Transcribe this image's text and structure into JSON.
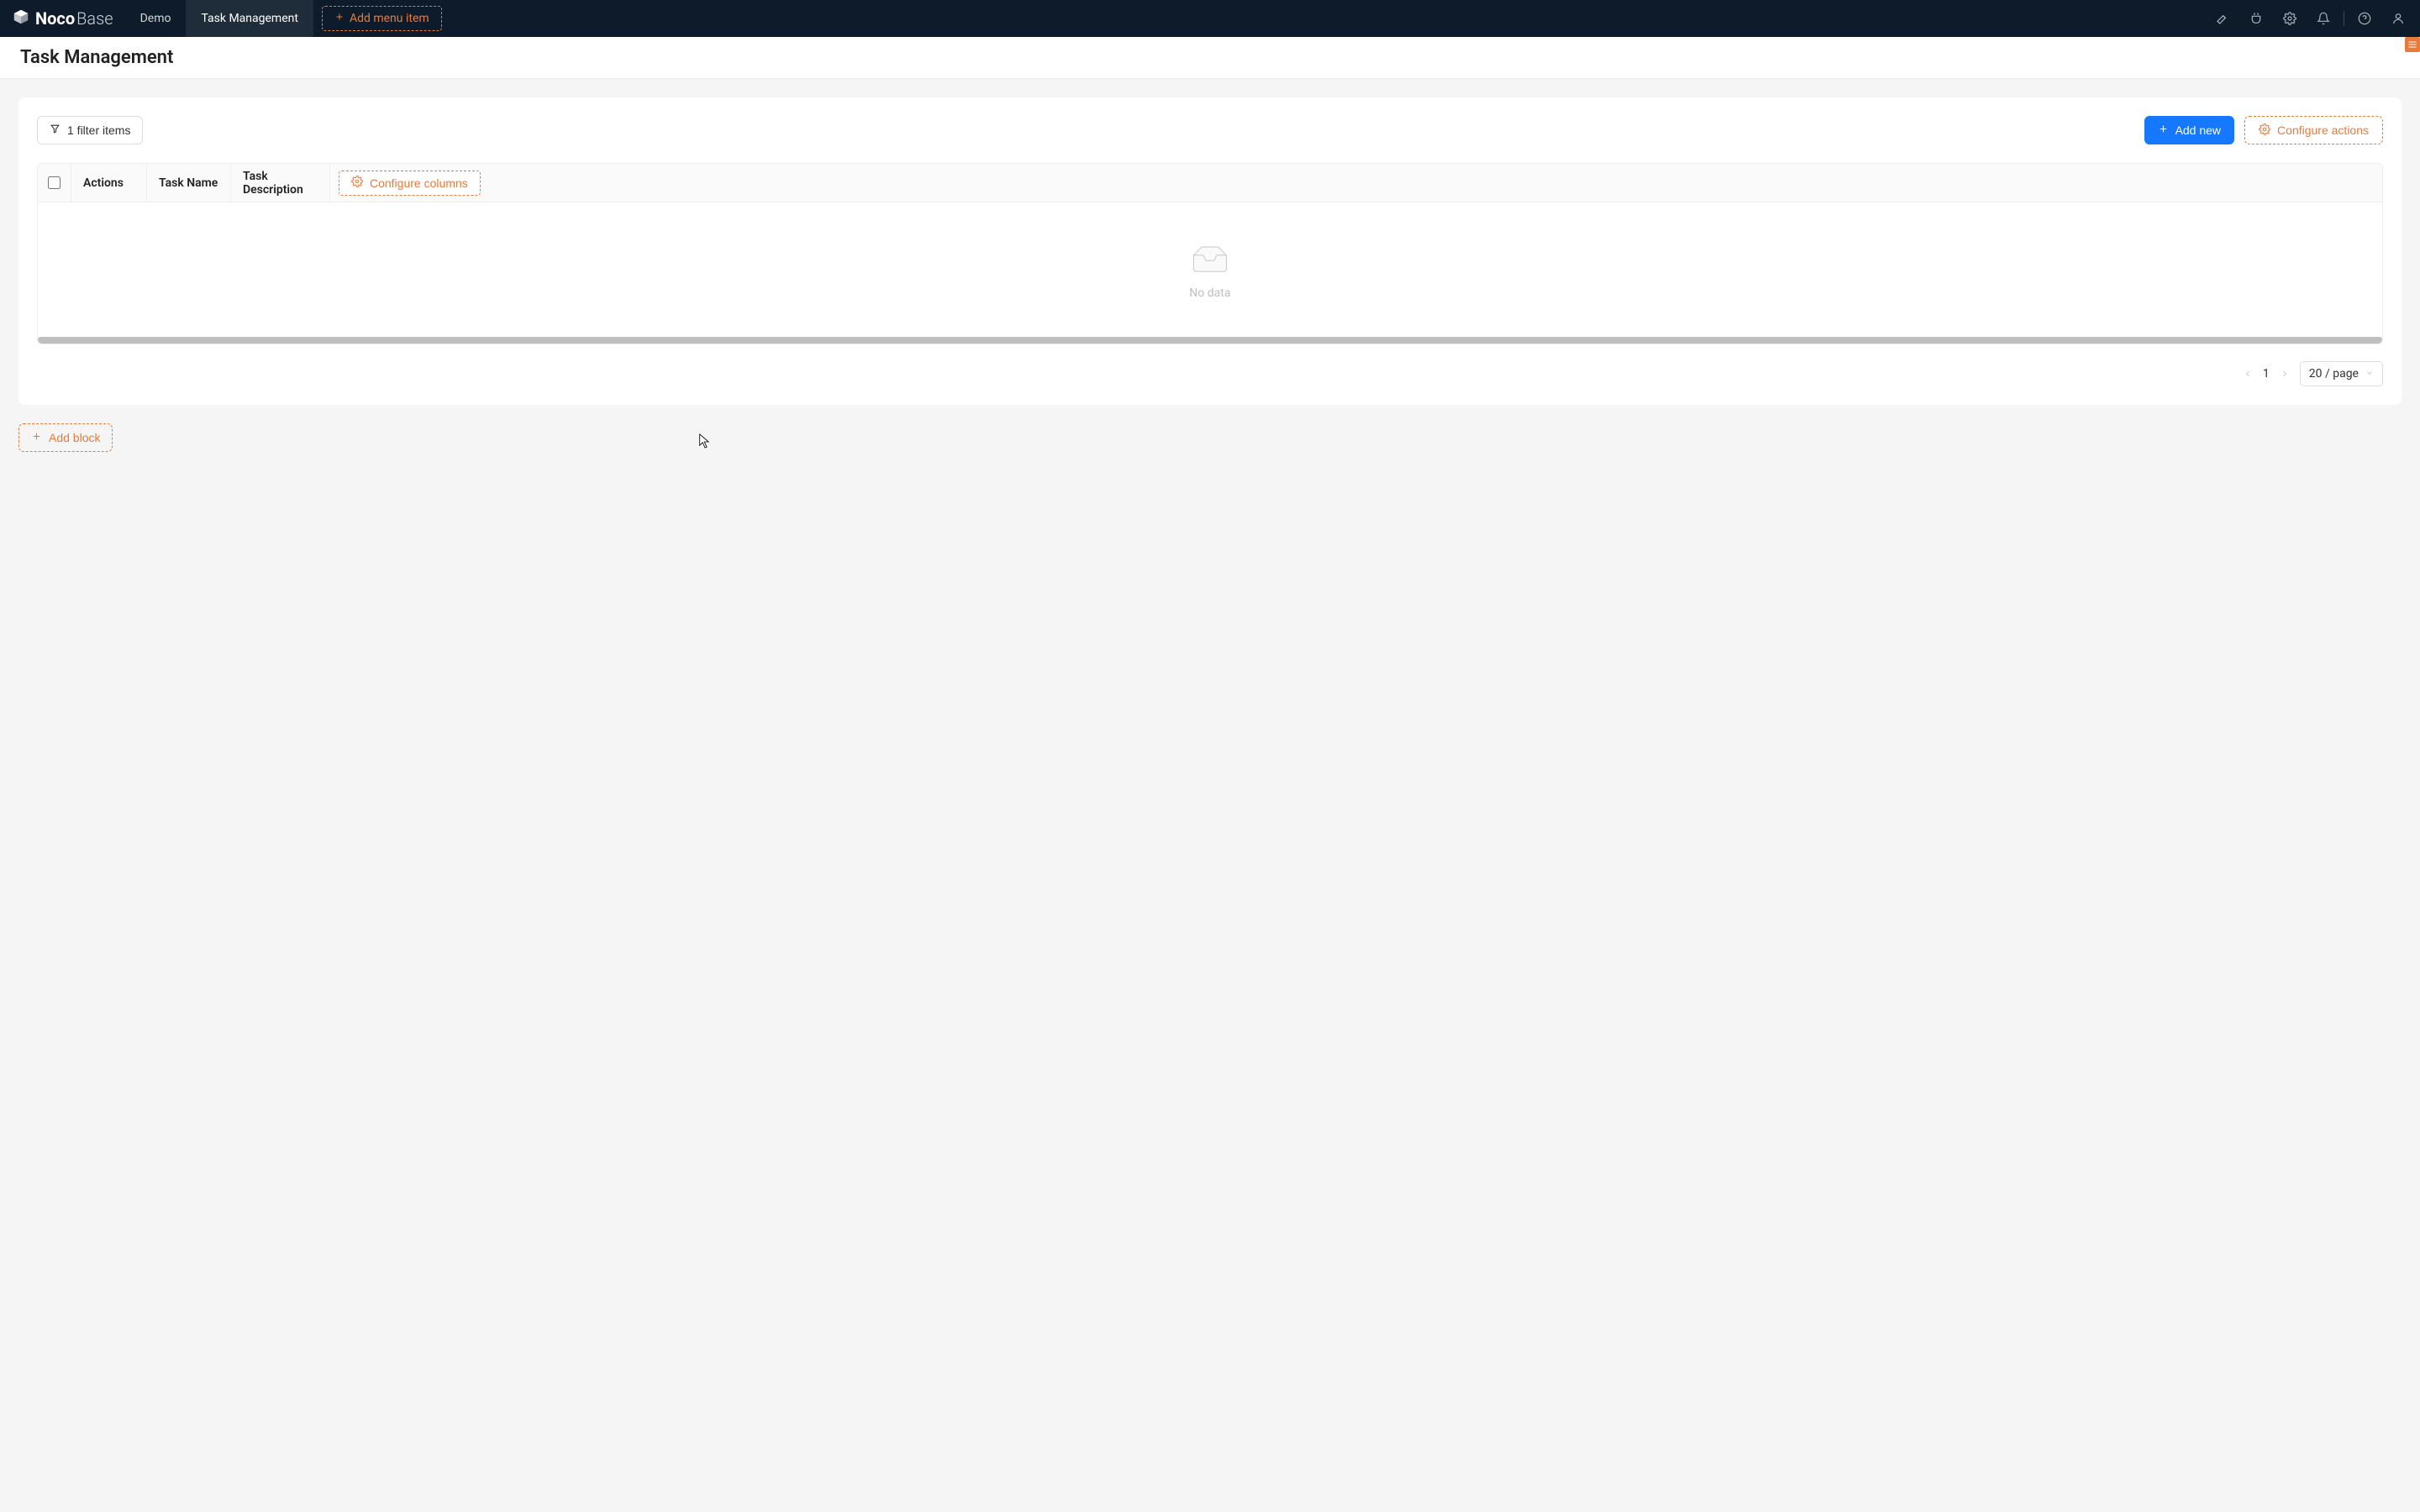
{
  "brand": {
    "name": "Noco",
    "suffix": "Base"
  },
  "nav": {
    "tabs": [
      {
        "label": "Demo",
        "active": false
      },
      {
        "label": "Task Management",
        "active": true
      }
    ],
    "add_menu_item": "Add menu item"
  },
  "page": {
    "title": "Task Management"
  },
  "toolbar": {
    "filter_label": "1 filter items",
    "add_new_label": "Add new",
    "configure_actions_label": "Configure actions"
  },
  "table": {
    "columns": {
      "actions": "Actions",
      "task_name": "Task Name",
      "task_description": "Task Description"
    },
    "configure_columns_label": "Configure columns",
    "empty_label": "No data",
    "rows": []
  },
  "pagination": {
    "current_page": "1",
    "page_size_label": "20 / page"
  },
  "below": {
    "add_block_label": "Add block"
  },
  "colors": {
    "accent_orange": "#e87a3b",
    "primary_blue": "#1677ff",
    "topbar_bg": "#0d1b2a"
  }
}
